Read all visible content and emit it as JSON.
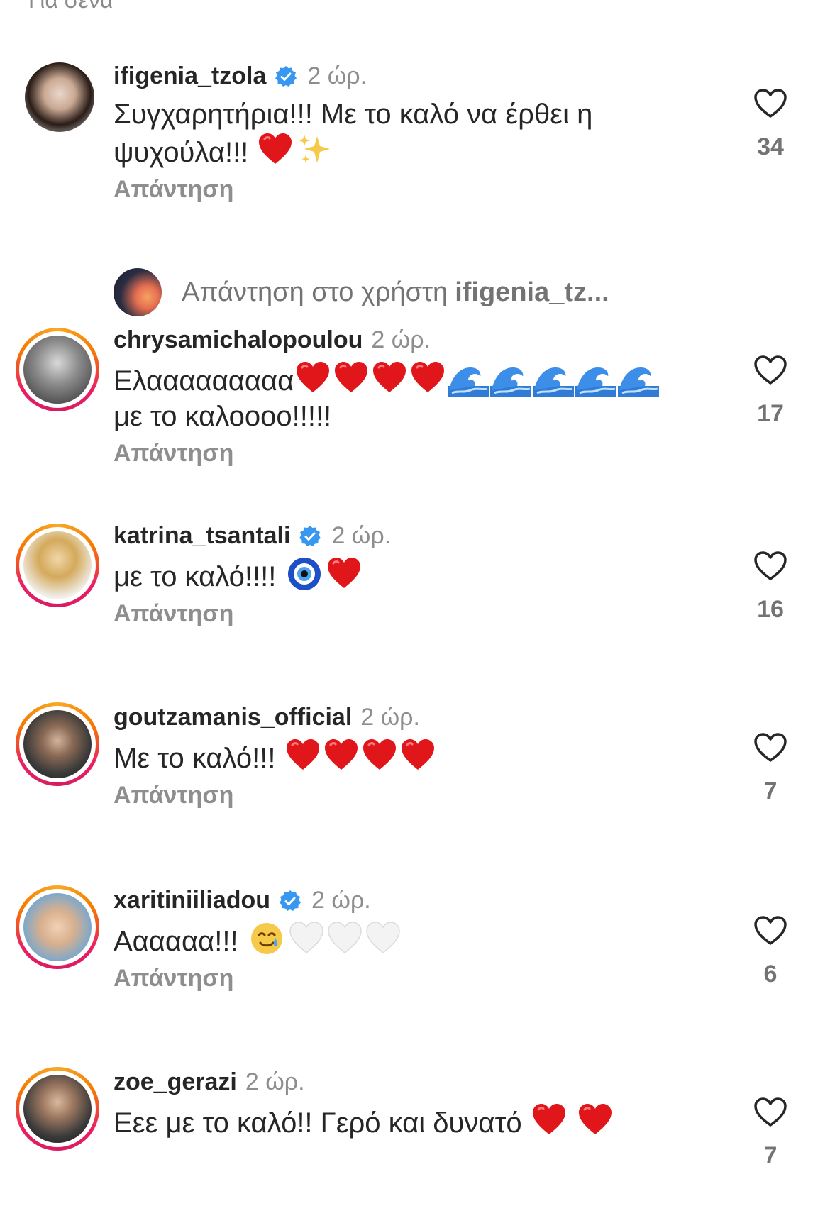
{
  "top_partial_text": "Για σένα",
  "reply_label": "Απάντηση",
  "view_replies": {
    "prefix": "Απάντηση στο χρήστη",
    "user": "ifigenia_tz..."
  },
  "comments": [
    {
      "username": "ifigenia_tzola",
      "verified": true,
      "time": "2 ώρ.",
      "text_line1": "Συγχαρητήρια!!! Με το καλό να έρθει η",
      "text_line2": "ψυχούλα!!!",
      "emojis": [
        "red-heart",
        "sparkles"
      ],
      "likes": "34"
    },
    {
      "username": "chrysamichalopoulou",
      "verified": false,
      "time": "2 ώρ.",
      "text_line1": "Ελααααααααα",
      "text_line2": "με το καλοooo!!!!!",
      "emojis": [
        "red-heart",
        "red-heart",
        "red-heart",
        "red-heart",
        "wave",
        "wave",
        "wave",
        "wave",
        "wave"
      ],
      "likes": "17"
    },
    {
      "username": "katrina_tsantali",
      "verified": true,
      "time": "2 ώρ.",
      "text_line1": "με το καλό!!!!",
      "emojis": [
        "nazar-amulet",
        "red-heart"
      ],
      "likes": "16"
    },
    {
      "username": "goutzamanis_official",
      "verified": false,
      "time": "2 ώρ.",
      "text_line1": "Με το καλό!!!",
      "emojis": [
        "red-heart",
        "red-heart",
        "red-heart",
        "red-heart"
      ],
      "likes": "7"
    },
    {
      "username": "xaritiniiliadou",
      "verified": true,
      "time": "2 ώρ.",
      "text_line1": "Αααααα!!!",
      "emojis": [
        "smiling-face-with-tear",
        "white-heart",
        "white-heart",
        "white-heart"
      ],
      "likes": "6"
    },
    {
      "username": "zoe_gerazi",
      "verified": false,
      "time": "2 ώρ.",
      "text_line1": "Εεε με το καλό!! Γερό και δυνατό",
      "emojis": [
        "red-heart",
        "red-heart"
      ],
      "likes": "7"
    }
  ],
  "colors": {
    "verified_blue": "#3897f0",
    "heart_red": "#e0161b",
    "muted_text": "#8e8e8e"
  }
}
